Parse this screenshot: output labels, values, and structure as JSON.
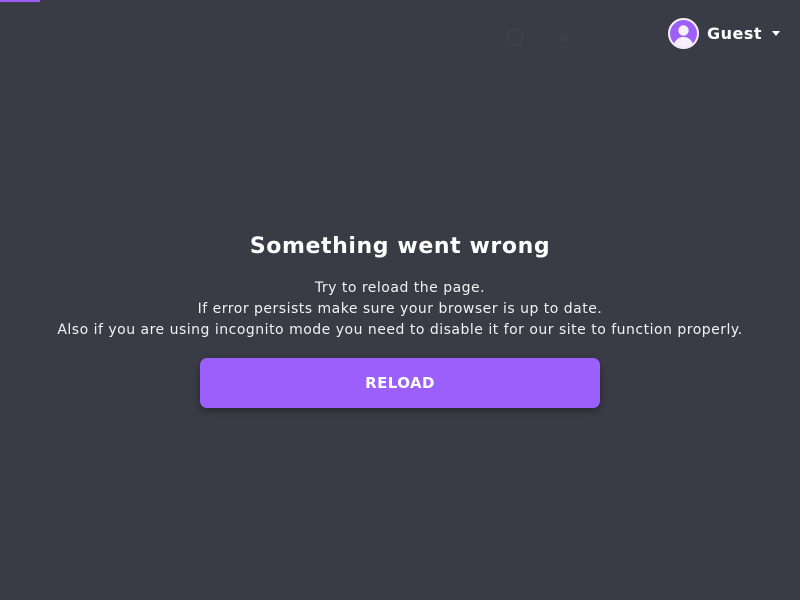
{
  "header": {
    "user": {
      "name": "Guest",
      "avatar_icon": "user-avatar-icon",
      "dropdown_icon": "caret-down-icon"
    }
  },
  "error": {
    "title": "Something went wrong",
    "lines": [
      "Try to reload the page.",
      "If error persists make sure your browser is up to date.",
      "Also if you are using incognito mode you need to disable it for our site to function properly."
    ],
    "reload_label": "RELOAD"
  },
  "colors": {
    "background": "#393c44",
    "accent": "#9b5ffc",
    "text": "#ffffff"
  }
}
